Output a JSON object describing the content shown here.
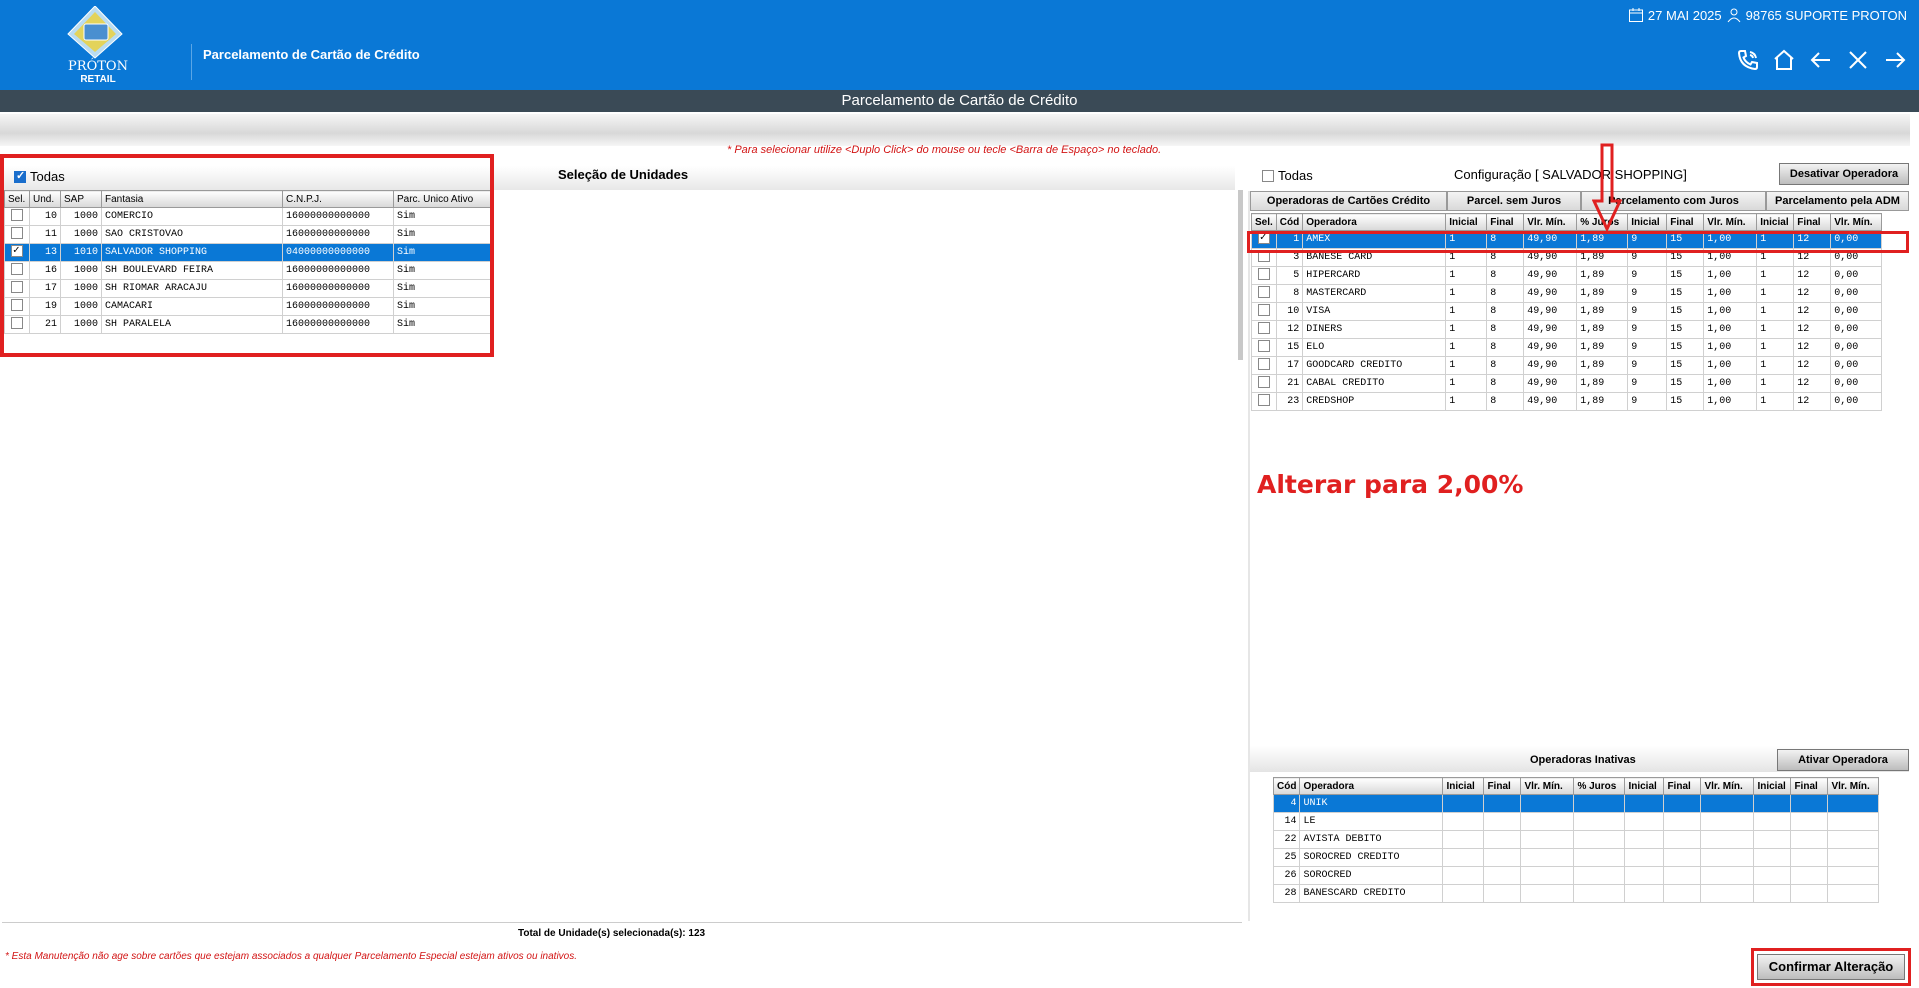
{
  "header": {
    "module_title": "Parcelamento de Cartão de Crédito",
    "date": "27 MAI 2025",
    "user": "98765 SUPORTE PROTON",
    "logo": {
      "line1": "PRÓTON",
      "line2": "RETAIL"
    },
    "icons": [
      "phone-icon",
      "home-icon",
      "back-arrow-icon",
      "close-icon",
      "forward-arrow-icon"
    ]
  },
  "window_title": "Parcelamento de Cartão de Crédito",
  "hint": "* Para selecionar utilize <Duplo Click> do mouse ou tecle <Barra de Espaço> no teclado.",
  "units": {
    "todas_label": "Todas",
    "todas_checked": true,
    "title": "Seleção de Unidades",
    "columns": [
      "Sel.",
      "Und.",
      "SAP",
      "Fantasia",
      "C.N.P.J.",
      "Parc. Unico Ativo"
    ],
    "rows": [
      {
        "sel": false,
        "und": "10",
        "sap": "1000",
        "fantasia": "COMERCIO",
        "cnpj": "16000000000000",
        "parc": "Sim"
      },
      {
        "sel": false,
        "und": "11",
        "sap": "1000",
        "fantasia": "SAO CRISTOVAO",
        "cnpj": "16000000000000",
        "parc": "Sim"
      },
      {
        "sel": true,
        "und": "13",
        "sap": "1010",
        "fantasia": "SALVADOR SHOPPING",
        "cnpj": "04000000000000",
        "parc": "Sim",
        "selected": true
      },
      {
        "sel": false,
        "und": "16",
        "sap": "1000",
        "fantasia": "SH BOULEVARD FEIRA",
        "cnpj": "16000000000000",
        "parc": "Sim"
      },
      {
        "sel": false,
        "und": "17",
        "sap": "1000",
        "fantasia": "SH RIOMAR ARACAJU",
        "cnpj": "16000000000000",
        "parc": "Sim"
      },
      {
        "sel": false,
        "und": "19",
        "sap": "1000",
        "fantasia": "CAMACARI",
        "cnpj": "16000000000000",
        "parc": "Sim"
      },
      {
        "sel": false,
        "und": "21",
        "sap": "1000",
        "fantasia": "SH PARALELA",
        "cnpj": "16000000000000",
        "parc": "Sim"
      }
    ],
    "total_label": "Total de Unidade(s) selecionada(s): 123"
  },
  "config": {
    "todas_label": "Todas",
    "title": "Configuração [ SALVADOR SHOPPING]",
    "deactivate_button": "Desativar Operadora",
    "tabs": [
      "Operadoras de Cartões Crédito",
      "Parcel.  sem Juros",
      "Parcelamento  com Juros",
      "Parcelamento pela ADM"
    ],
    "columns": [
      "Sel.",
      "Cód",
      "Operadora",
      "Inicial",
      "Final",
      "Vlr. Mín.",
      "% Juros",
      "Inicial",
      "Final",
      "Vlr. Mín.",
      "Inicial",
      "Final",
      "Vlr. Mín."
    ],
    "rows": [
      {
        "sel": true,
        "cod": "1",
        "op": "AMEX",
        "v": [
          "1",
          "8",
          "49,90",
          "1,89",
          "9",
          "15",
          "1,00",
          "1",
          "12",
          "0,00"
        ],
        "selected": true
      },
      {
        "sel": false,
        "cod": "3",
        "op": "BANESE CARD",
        "v": [
          "1",
          "8",
          "49,90",
          "1,89",
          "9",
          "15",
          "1,00",
          "1",
          "12",
          "0,00"
        ]
      },
      {
        "sel": false,
        "cod": "5",
        "op": "HIPERCARD",
        "v": [
          "1",
          "8",
          "49,90",
          "1,89",
          "9",
          "15",
          "1,00",
          "1",
          "12",
          "0,00"
        ]
      },
      {
        "sel": false,
        "cod": "8",
        "op": "MASTERCARD",
        "v": [
          "1",
          "8",
          "49,90",
          "1,89",
          "9",
          "15",
          "1,00",
          "1",
          "12",
          "0,00"
        ]
      },
      {
        "sel": false,
        "cod": "10",
        "op": "VISA",
        "v": [
          "1",
          "8",
          "49,90",
          "1,89",
          "9",
          "15",
          "1,00",
          "1",
          "12",
          "0,00"
        ]
      },
      {
        "sel": false,
        "cod": "12",
        "op": "DINERS",
        "v": [
          "1",
          "8",
          "49,90",
          "1,89",
          "9",
          "15",
          "1,00",
          "1",
          "12",
          "0,00"
        ]
      },
      {
        "sel": false,
        "cod": "15",
        "op": "ELO",
        "v": [
          "1",
          "8",
          "49,90",
          "1,89",
          "9",
          "15",
          "1,00",
          "1",
          "12",
          "0,00"
        ]
      },
      {
        "sel": false,
        "cod": "17",
        "op": "GOODCARD CREDITO",
        "v": [
          "1",
          "8",
          "49,90",
          "1,89",
          "9",
          "15",
          "1,00",
          "1",
          "12",
          "0,00"
        ]
      },
      {
        "sel": false,
        "cod": "21",
        "op": "CABAL CREDITO",
        "v": [
          "1",
          "8",
          "49,90",
          "1,89",
          "9",
          "15",
          "1,00",
          "1",
          "12",
          "0,00"
        ]
      },
      {
        "sel": false,
        "cod": "23",
        "op": "CREDSHOP",
        "v": [
          "1",
          "8",
          "49,90",
          "1,89",
          "9",
          "15",
          "1,00",
          "1",
          "12",
          "0,00"
        ]
      }
    ]
  },
  "annotation": "Alterar para 2,00%",
  "inactive": {
    "title": "Operadoras Inativas",
    "activate_button": "Ativar Operadora",
    "columns": [
      "Cód",
      "Operadora",
      "Inicial",
      "Final",
      "Vlr. Mín.",
      "% Juros",
      "Inicial",
      "Final",
      "Vlr. Mín.",
      "Inicial",
      "Final",
      "Vlr. Mín."
    ],
    "rows": [
      {
        "cod": "4",
        "op": "UNIK",
        "selected": true
      },
      {
        "cod": "14",
        "op": "LE"
      },
      {
        "cod": "22",
        "op": "AVISTA DEBITO"
      },
      {
        "cod": "25",
        "op": "SOROCRED CREDITO"
      },
      {
        "cod": "26",
        "op": "SOROCRED"
      },
      {
        "cod": "28",
        "op": "BANESCARD CREDITO"
      }
    ]
  },
  "footer_note": "* Esta Manutenção não age sobre cartões que estejam associados a qualquer Parcelamento Especial estejam ativos ou inativos.",
  "confirm_button": "Confirmar Alteração",
  "colors": {
    "header_blue": "#0a78d6",
    "titlebar": "#3a4a56",
    "annotation_red": "#e02020",
    "hint_red": "#d21414"
  }
}
